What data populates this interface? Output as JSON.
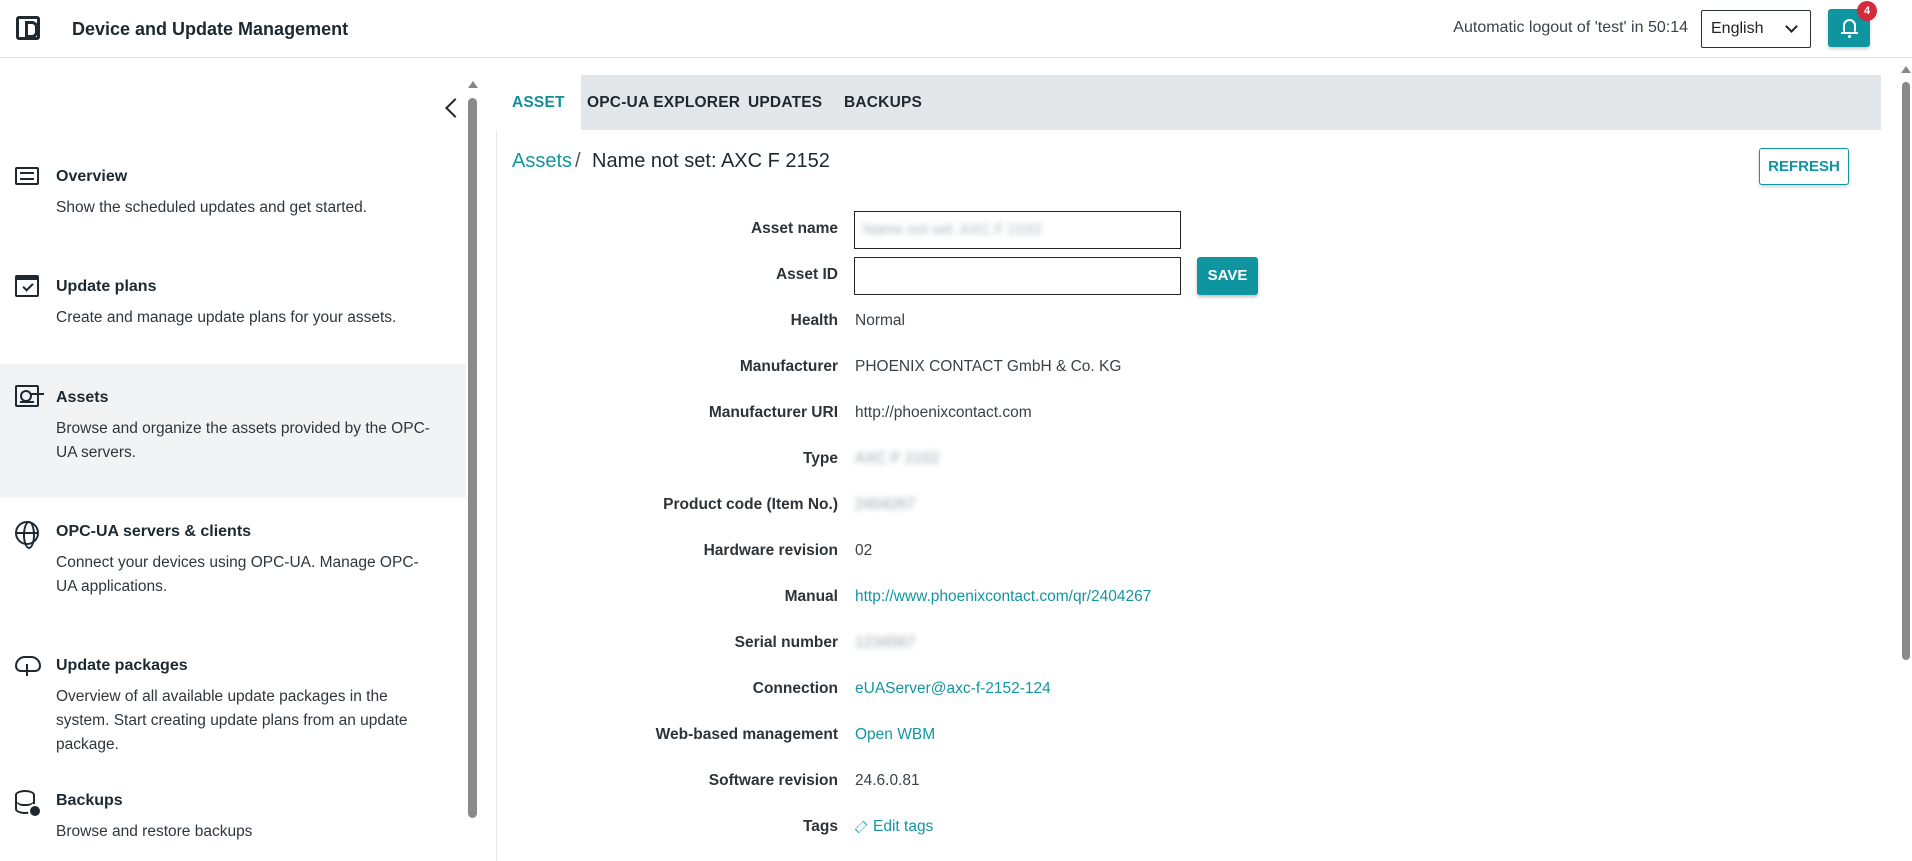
{
  "header": {
    "app_title": "Device and Update Management",
    "logout_text": "Automatic logout of 'test' in 50:14",
    "language": "English",
    "notification_count": "4"
  },
  "sidebar": {
    "items": [
      {
        "title": "Overview",
        "desc": "Show the scheduled updates and get started.",
        "icon": "list-icon"
      },
      {
        "title": "Update plans",
        "desc": "Create and manage update plans for your assets.",
        "icon": "calendar-check-icon"
      },
      {
        "title": "Assets",
        "desc": "Browse and organize the assets provided by the OPC-UA servers.",
        "icon": "asset-icon"
      },
      {
        "title": "OPC-UA servers & clients",
        "desc": "Connect your devices using OPC-UA. Manage OPC-UA applications.",
        "icon": "globe-icon"
      },
      {
        "title": "Update packages",
        "desc": "Overview of all available update packages in the system. Start creating update plans from an update package.",
        "icon": "cloud-download-icon"
      },
      {
        "title": "Backups",
        "desc": "Browse and restore backups",
        "icon": "database-icon"
      }
    ]
  },
  "tabs": [
    "ASSET",
    "OPC-UA EXPLORER",
    "UPDATES",
    "BACKUPS"
  ],
  "breadcrumb": {
    "link": "Assets",
    "separator": "/",
    "current": "Name not set: AXC F 2152"
  },
  "buttons": {
    "refresh": "REFRESH",
    "save": "SAVE"
  },
  "fields": {
    "asset_name": {
      "label": "Asset name",
      "value": "Name not set: AXC F 2152"
    },
    "asset_id": {
      "label": "Asset ID",
      "value": ""
    },
    "health": {
      "label": "Health",
      "value": "Normal"
    },
    "manufacturer": {
      "label": "Manufacturer",
      "value": "PHOENIX CONTACT GmbH & Co. KG"
    },
    "manufacturer_uri": {
      "label": "Manufacturer URI",
      "value": "http://phoenixcontact.com"
    },
    "type": {
      "label": "Type",
      "value": "AXC F 2152"
    },
    "product_code": {
      "label": "Product code (Item No.)",
      "value": "2404267"
    },
    "hardware_revision": {
      "label": "Hardware revision",
      "value": "02"
    },
    "manual": {
      "label": "Manual",
      "value": "http://www.phoenixcontact.com/qr/2404267"
    },
    "serial_number": {
      "label": "Serial number",
      "value": "1234567"
    },
    "connection": {
      "label": "Connection",
      "value": "eUAServer@axc-f-2152-124"
    },
    "wbm": {
      "label": "Web-based management",
      "value": "Open WBM"
    },
    "software_revision": {
      "label": "Software revision",
      "value": "24.6.0.81"
    },
    "tags": {
      "label": "Tags",
      "value": "Edit tags"
    }
  },
  "colors": {
    "accent": "#0f95a0",
    "link": "#1296a2",
    "badge": "#d32b3c"
  }
}
